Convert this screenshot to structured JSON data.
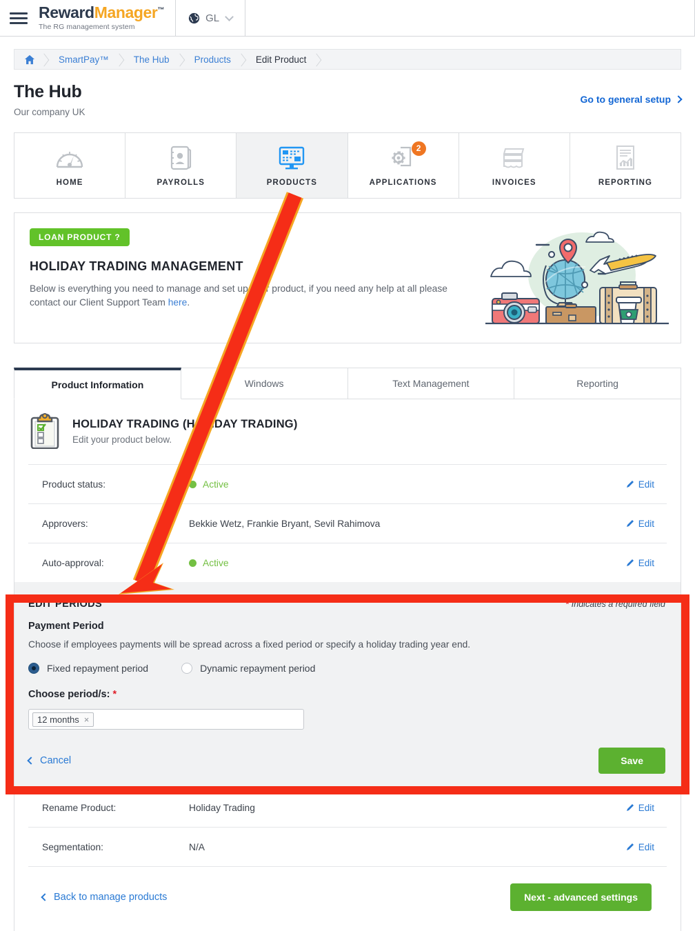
{
  "topbar": {
    "menu_icon": "hamburger-menu-icon",
    "brand_part1": "Reward",
    "brand_part2": "Manager",
    "brand_tm": "™",
    "brand_tagline": "The RG management system",
    "locale_icon": "globe-icon",
    "locale_label": "GL",
    "locale_chevron": "chevron-down-icon"
  },
  "breadcrumb": {
    "home_icon": "home-icon",
    "items": [
      {
        "label": "SmartPay™",
        "current": false
      },
      {
        "label": "The Hub",
        "current": false
      },
      {
        "label": "Products",
        "current": false
      },
      {
        "label": "Edit Product",
        "current": true
      }
    ]
  },
  "header": {
    "title": "The Hub",
    "subtitle": "Our company UK",
    "general_setup_link": "Go to general setup",
    "general_setup_chevron": "chevron-right-icon"
  },
  "nav_tiles": [
    {
      "label": "HOME",
      "icon": "speedometer-icon",
      "active": false,
      "badge": null
    },
    {
      "label": "PAYROLLS",
      "icon": "address-book-icon",
      "active": false,
      "badge": null
    },
    {
      "label": "PRODUCTS",
      "icon": "monitor-icon",
      "active": true,
      "badge": null
    },
    {
      "label": "APPLICATIONS",
      "icon": "gear-document-icon",
      "active": false,
      "badge": "2"
    },
    {
      "label": "INVOICES",
      "icon": "receipt-icon",
      "active": false,
      "badge": null
    },
    {
      "label": "REPORTING",
      "icon": "report-chart-icon",
      "active": false,
      "badge": null
    }
  ],
  "banner": {
    "pill": "LOAN PRODUCT ?",
    "heading": "HOLIDAY TRADING MANAGEMENT",
    "body_before_link": "Below is everything you need to manage and set up your product, if you need any help at all please contact our Client Support Team ",
    "body_link": "here",
    "body_after_link": ".",
    "illustration": "travel-illustration"
  },
  "product_tabs": [
    {
      "label": "Product Information",
      "active": true
    },
    {
      "label": "Windows",
      "active": false
    },
    {
      "label": "Text Management",
      "active": false
    },
    {
      "label": "Reporting",
      "active": false
    }
  ],
  "product_header": {
    "icon": "clipboard-checklist-icon",
    "title": "HOLIDAY TRADING (HOLIDAY TRADING)",
    "subtitle": "Edit your product below."
  },
  "rows_top": [
    {
      "label": "Product status:",
      "value": "Active",
      "status": true,
      "edit": "Edit",
      "edit_icon": "pencil-icon"
    },
    {
      "label": "Approvers:",
      "value": "Bekkie Wetz, Frankie Bryant, Sevil Rahimova",
      "status": false,
      "edit": "Edit",
      "edit_icon": "pencil-icon"
    },
    {
      "label": "Auto-approval:",
      "value": "Active",
      "status": true,
      "edit": "Edit",
      "edit_icon": "pencil-icon"
    }
  ],
  "edit_periods": {
    "title": "EDIT PERIODS",
    "required_star": "*",
    "required_note": " Indicates a required field",
    "subtitle": "Payment Period",
    "description": "Choose if employees payments will be spread across a fixed period or specify a holiday trading year end.",
    "radios": [
      {
        "label": "Fixed repayment period",
        "selected": true
      },
      {
        "label": "Dynamic repayment period",
        "selected": false
      }
    ],
    "field_label": "Choose period/s:",
    "field_star": "*",
    "tags": [
      {
        "label": "12 months",
        "remove_icon": "×"
      }
    ],
    "cancel_label": "Cancel",
    "cancel_chevron": "chevron-left-icon",
    "save_label": "Save"
  },
  "rows_bottom": [
    {
      "label": "Rename Product:",
      "value": "Holiday Trading",
      "edit": "Edit",
      "edit_icon": "pencil-icon"
    },
    {
      "label": "Segmentation:",
      "value": "N/A",
      "edit": "Edit",
      "edit_icon": "pencil-icon"
    }
  ],
  "footer": {
    "back_label": "Back to manage products",
    "back_chevron": "chevron-left-icon",
    "next_label": "Next - advanced settings"
  },
  "annotations": {
    "arrow": "red-arrow-pointing-to-edit-periods",
    "highlight_box": "red-rectangle-highlight-edit-periods",
    "accent_red": "#f52d17",
    "accent_green": "#5cb130",
    "accent_blue": "#2a7ad4",
    "accent_orange": "#ef7622",
    "status_green": "#74c043"
  }
}
